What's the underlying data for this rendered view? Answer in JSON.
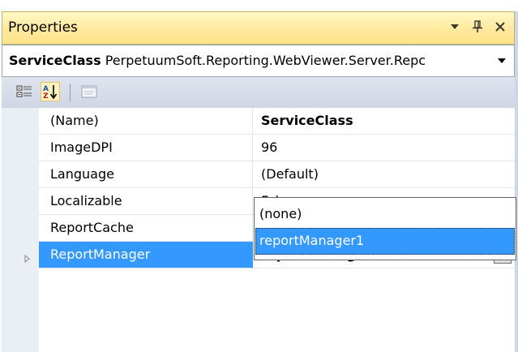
{
  "panel": {
    "title": "Properties",
    "buttons": [
      "window-position-dropdown",
      "auto-hide-pin",
      "close"
    ]
  },
  "object_selector": {
    "name": "ServiceClass",
    "type": "PerpetuumSoft.Reporting.WebViewer.Server.Repc"
  },
  "toolbar": {
    "tools": [
      {
        "name": "categorized-icon",
        "checked": false
      },
      {
        "name": "alphabetical-icon",
        "checked": true
      },
      {
        "name": "property-pages-icon",
        "checked": false,
        "disabled": true
      }
    ]
  },
  "properties": [
    {
      "name": "(Name)",
      "value": "ServiceClass",
      "bold": true
    },
    {
      "name": "ImageDPI",
      "value": "96",
      "bold": false
    },
    {
      "name": "Language",
      "value": "(Default)",
      "bold": false
    },
    {
      "name": "Localizable",
      "value": "False",
      "bold": false
    },
    {
      "name": "ReportCache",
      "value": "",
      "bold": false
    },
    {
      "name": "ReportManager",
      "value": "reportManager1",
      "bold": true,
      "selected": true,
      "expandable": true
    }
  ],
  "dropdown": {
    "options": [
      "(none)",
      "reportManager1"
    ],
    "selected": "reportManager1"
  },
  "colors": {
    "title_bar": "#ffe99d",
    "selection": "#3399ff",
    "chrome": "#cfd6e5"
  }
}
